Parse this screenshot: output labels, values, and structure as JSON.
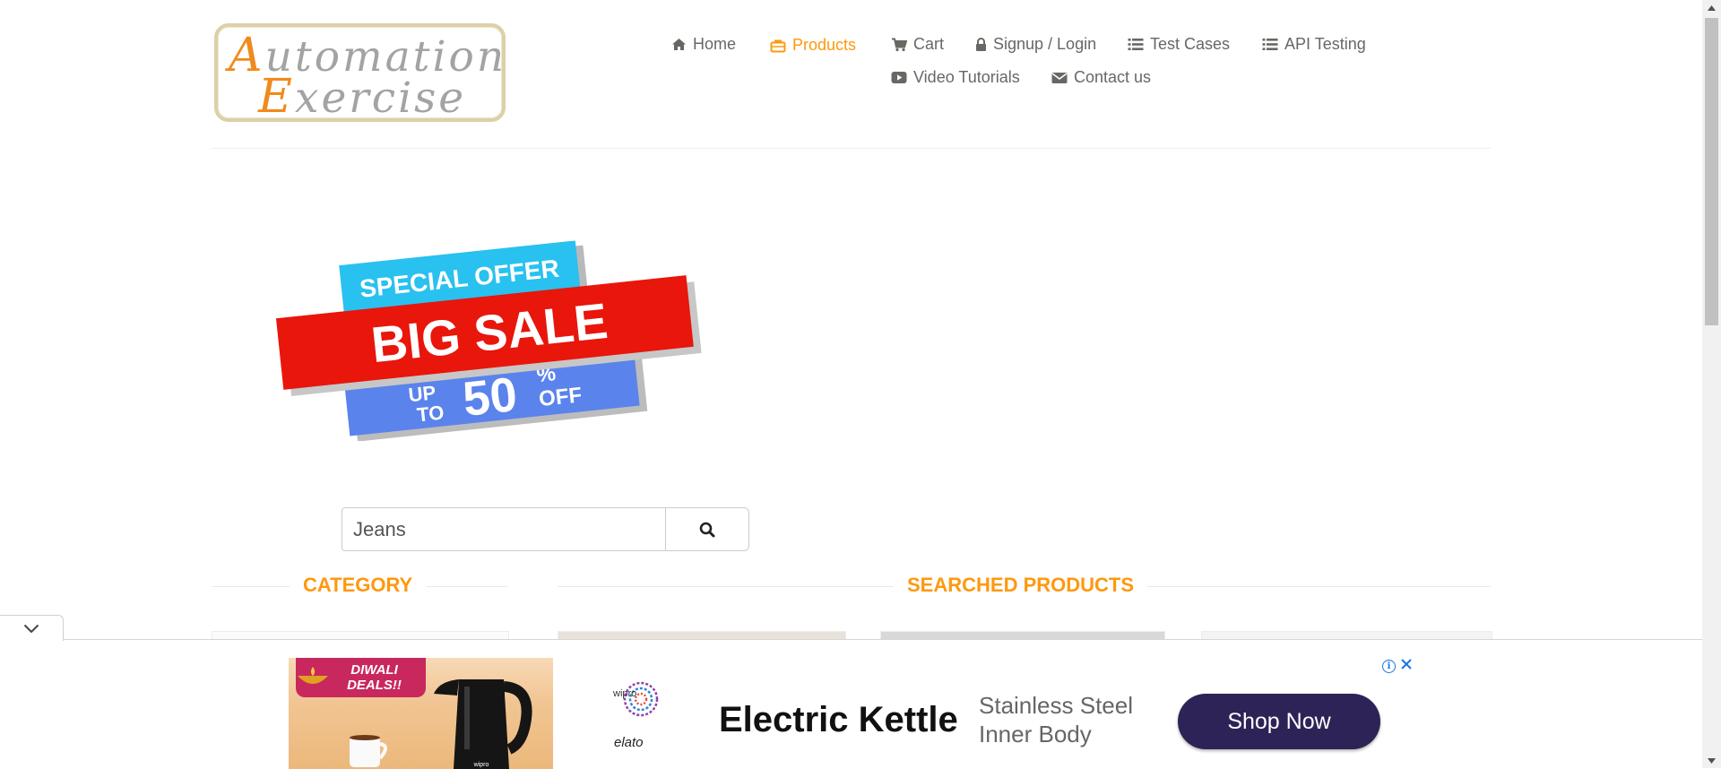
{
  "logo": {
    "line1_cap": "A",
    "line1_rest": "utomation",
    "line2_cap": "E",
    "line2_rest": "xercise"
  },
  "nav": [
    {
      "label": "Home",
      "icon": "home-icon"
    },
    {
      "label": "Products",
      "icon": "briefcase-icon",
      "active": true
    },
    {
      "label": "Cart",
      "icon": "cart-icon"
    },
    {
      "label": "Signup / Login",
      "icon": "lock-icon"
    },
    {
      "label": "Test Cases",
      "icon": "list-icon"
    },
    {
      "label": "API Testing",
      "icon": "list-icon"
    },
    {
      "label": "Video Tutorials",
      "icon": "youtube-play-icon"
    },
    {
      "label": "Contact us",
      "icon": "envelope-icon"
    }
  ],
  "banner": {
    "line1": "SPECIAL OFFER",
    "line2": "BIG SALE",
    "up": "UP",
    "to": "TO",
    "percent": "50",
    "percent_sign": "%",
    "off": "OFF"
  },
  "search": {
    "value": "Jeans",
    "icon": "search-icon"
  },
  "sections": {
    "category": "CATEGORY",
    "searched": "SEARCHED PRODUCTS"
  },
  "ad": {
    "badge": "DIWALI DEALS!!",
    "brand1": "wipro",
    "brand2": "elato",
    "product_brand": "wipro",
    "title": "Electric Kettle",
    "subtitle": "Stainless Steel Inner Body",
    "cta": "Shop Now"
  },
  "colors": {
    "accent": "#fe980f",
    "nav_text": "#696763",
    "ad_cta": "#2e2357",
    "banner_red": "#e8160b",
    "banner_cyan": "#29c1ef",
    "banner_blue": "#5a83ec"
  }
}
